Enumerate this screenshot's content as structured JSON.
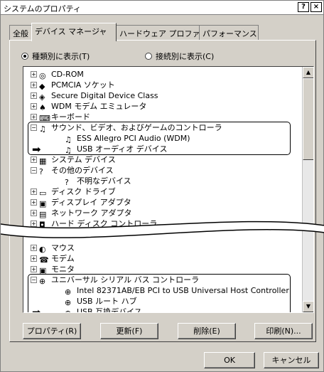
{
  "window": {
    "title": "システムのプロパティ",
    "help_btn": "?",
    "close_btn": "×"
  },
  "tabs": [
    {
      "label": "全般"
    },
    {
      "label": "デバイス マネージャ"
    },
    {
      "label": "ハードウェア プロファイル"
    },
    {
      "label": "パフォーマンス"
    }
  ],
  "view": {
    "by_type": "種類別に表示(T)",
    "by_connection": "接続別に表示(C)"
  },
  "tree": [
    {
      "label": "CD-ROM",
      "icon": "cdrom-icon",
      "level": 0,
      "expander": "+"
    },
    {
      "label": "PCMCIA ソケット",
      "icon": "pcmcia-icon",
      "level": 0,
      "expander": "+"
    },
    {
      "label": "Secure Digital Device Class",
      "icon": "sd-card-icon",
      "level": 0,
      "expander": "+"
    },
    {
      "label": "WDM モデム エミュレータ",
      "icon": "modem-emulator-icon",
      "level": 0,
      "expander": "+"
    },
    {
      "label": "キーボード",
      "icon": "keyboard-icon",
      "level": 0,
      "expander": "+"
    },
    {
      "label": "サウンド、ビデオ、およびゲームのコントローラ",
      "icon": "sound-controller-icon",
      "level": 0,
      "expander": "−"
    },
    {
      "label": "ESS Allegro PCI Audio (WDM)",
      "icon": "audio-device-icon",
      "level": 1,
      "expander": ""
    },
    {
      "label": "USB オーディオ デバイス",
      "icon": "audio-device-icon",
      "level": 1,
      "expander": ""
    },
    {
      "label": "システム デバイス",
      "icon": "system-device-icon",
      "level": 0,
      "expander": "+"
    },
    {
      "label": "その他のデバイス",
      "icon": "unknown-device-icon",
      "level": 0,
      "expander": "−"
    },
    {
      "label": "不明なデバイス",
      "icon": "unknown-device-icon",
      "level": 1,
      "expander": ""
    },
    {
      "label": "ディスク ドライブ",
      "icon": "disk-drive-icon",
      "level": 0,
      "expander": "+"
    },
    {
      "label": "ディスプレイ アダプタ",
      "icon": "display-adapter-icon",
      "level": 0,
      "expander": "+"
    },
    {
      "label": "ネットワーク アダプタ",
      "icon": "network-adapter-icon",
      "level": 0,
      "expander": "+"
    },
    {
      "label": "ハード ディスク コントローラ",
      "icon": "hdd-controller-icon",
      "level": 0,
      "expander": "+"
    },
    {
      "label": "マウス",
      "icon": "mouse-icon",
      "level": 0,
      "expander": "+"
    },
    {
      "label": "モデム",
      "icon": "modem-icon",
      "level": 0,
      "expander": "+"
    },
    {
      "label": "モニタ",
      "icon": "monitor-icon",
      "level": 0,
      "expander": "+"
    },
    {
      "label": "ユニバーサル シリアル バス コントローラ",
      "icon": "usb-controller-icon",
      "level": 0,
      "expander": "−"
    },
    {
      "label": "Intel 82371AB/EB PCI to USB Universal Host Controller",
      "icon": "usb-controller-icon",
      "level": 1,
      "expander": ""
    },
    {
      "label": "USB ルート ハブ",
      "icon": "usb-controller-icon",
      "level": 1,
      "expander": ""
    },
    {
      "label": "USB 互換デバイス",
      "icon": "usb-controller-icon",
      "level": 1,
      "expander": ""
    }
  ],
  "buttons": {
    "properties": "プロパティ(R)",
    "refresh": "更新(F)",
    "remove": "削除(E)",
    "print": "印刷(N)...",
    "ok": "OK",
    "cancel": "キャンセル"
  }
}
